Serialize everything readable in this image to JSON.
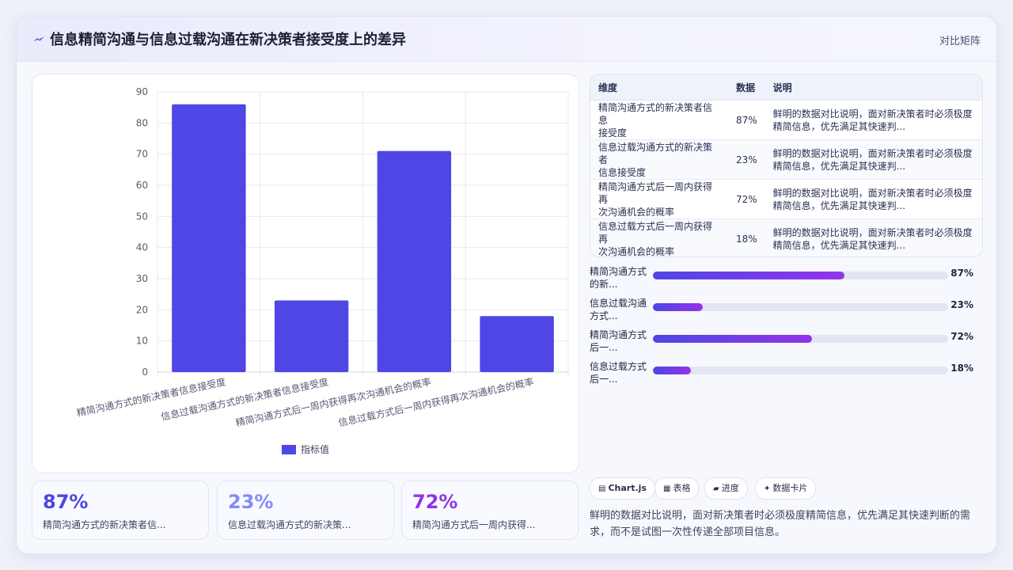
{
  "header": {
    "icon": "lightning-icon",
    "title": "信息精简沟通与信息过载沟通在新决策者接受度上的差异",
    "tag": "对比矩阵"
  },
  "chart_data": {
    "type": "bar",
    "categories": [
      "精简沟通方式的新决策者信息接受度",
      "信息过载沟通方式的新决策者信息接受度",
      "精简沟通方式后一周内获得再次沟通机会的概率",
      "信息过载方式后一周内获得再次沟通机会的概率"
    ],
    "series": [
      {
        "name": "指标值",
        "values": [
          86,
          23,
          71,
          18
        ],
        "color": "#4f46e5"
      }
    ],
    "ylim": [
      0,
      90
    ],
    "yticks": [
      0,
      10,
      20,
      30,
      40,
      50,
      60,
      70,
      80,
      90
    ],
    "grid": true,
    "legend": "bottom"
  },
  "stats": [
    {
      "value": "87%",
      "caption": "精简沟通方式的新决策者信...",
      "color": "#4f46e5"
    },
    {
      "value": "23%",
      "caption": "信息过载沟通方式的新决策...",
      "color": "#818cf8"
    },
    {
      "value": "72%",
      "caption": "精简沟通方式后一周内获得...",
      "color": "#9333ea"
    }
  ],
  "table": {
    "headers": [
      "维度",
      "数据",
      "说明"
    ],
    "rows": [
      {
        "dim": [
          "精简沟通方式的新决策者信息",
          "接受度"
        ],
        "value": "87%",
        "note": [
          "鲜明的数据对比说明，面对新决策者时必须极度",
          "精简信息，优先满足其快速判..."
        ]
      },
      {
        "dim": [
          "信息过载沟通方式的新决策者",
          "信息接受度"
        ],
        "value": "23%",
        "note": [
          "鲜明的数据对比说明，面对新决策者时必须极度",
          "精简信息，优先满足其快速判..."
        ]
      },
      {
        "dim": [
          "精简沟通方式后一周内获得再",
          "次沟通机会的概率"
        ],
        "value": "72%",
        "note": [
          "鲜明的数据对比说明，面对新决策者时必须极度",
          "精简信息，优先满足其快速判..."
        ]
      },
      {
        "dim": [
          "信息过载方式后一周内获得再",
          "次沟通机会的概率"
        ],
        "value": "18%",
        "note": [
          "鲜明的数据对比说明，面对新决策者时必须极度",
          "精简信息，优先满足其快速判..."
        ]
      }
    ]
  },
  "progress": [
    {
      "label": [
        "精简沟通方式",
        "的新..."
      ],
      "value": "87%",
      "fraction": 0.65
    },
    {
      "label": [
        "信息过载沟通",
        "方式..."
      ],
      "value": "23%",
      "fraction": 0.17
    },
    {
      "label": [
        "精简沟通方式",
        "后一..."
      ],
      "value": "72%",
      "fraction": 0.54
    },
    {
      "label": [
        "信息过载方式",
        "后一..."
      ],
      "value": "18%",
      "fraction": 0.13
    }
  ],
  "chips": [
    {
      "icon": "chart-icon",
      "glyph": "▤",
      "label": "Chart.js"
    },
    {
      "icon": "table-icon",
      "glyph": "▦",
      "label": "表格"
    },
    {
      "icon": "progress-icon",
      "glyph": "▰",
      "label": "进度"
    },
    {
      "icon": "sparkle-icon",
      "glyph": "✦",
      "label": "数据卡片"
    }
  ],
  "description": "鲜明的数据对比说明，面对新决策者时必须极度精简信息，优先满足其快速判断的需求，而不是试图一次性传递全部项目信息。"
}
